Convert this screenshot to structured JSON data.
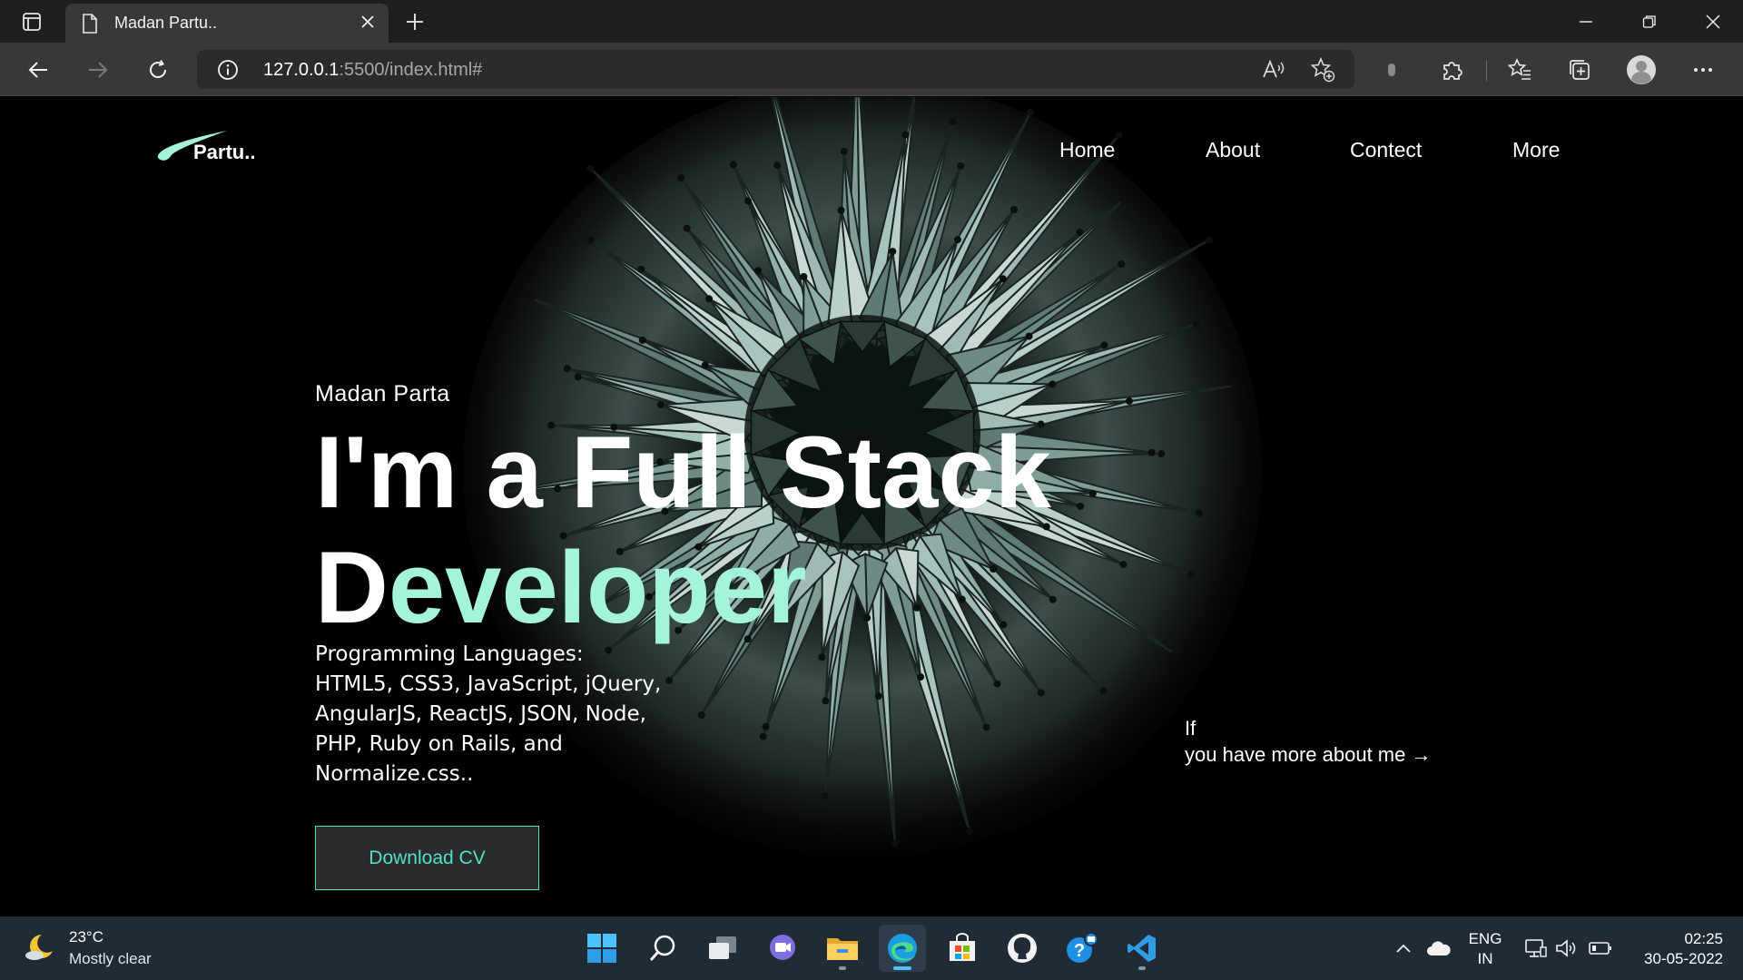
{
  "browser": {
    "tab_title": "Madan Partu..",
    "url_host": "127.0.0.1",
    "url_rest": ":5500/index.html#"
  },
  "site": {
    "logo_text": "Partu..",
    "nav": [
      "Home",
      "About",
      "Contect",
      "More"
    ],
    "hero": {
      "name": "Madan Parta",
      "title_line1": "I'm a Full Stack",
      "title_d": "D",
      "title_rest": "eveloper",
      "skills_heading": "Programming Languages:",
      "skills_line1": "HTML5, CSS3, JavaScript, jQuery,",
      "skills_line2": "AngularJS, ReactJS, JSON, Node,",
      "skills_line3": "PHP, Ruby on Rails, and",
      "skills_line4": "Normalize.css..",
      "cv_button": "Download CV",
      "more_line1": "If",
      "more_line2": "you have more about me →"
    },
    "accent_color": "#a4f4dc",
    "button_color": "#4ee0ca"
  },
  "taskbar": {
    "temperature": "23°C",
    "condition": "Mostly clear",
    "lang_line1": "ENG",
    "lang_line2": "IN",
    "time": "02:25",
    "date": "30-05-2022",
    "apps": [
      "start-icon",
      "search-icon",
      "task-view-icon",
      "chat-icon",
      "file-explorer-icon",
      "edge-icon",
      "store-icon",
      "github-icon",
      "help-icon",
      "vscode-icon"
    ]
  }
}
